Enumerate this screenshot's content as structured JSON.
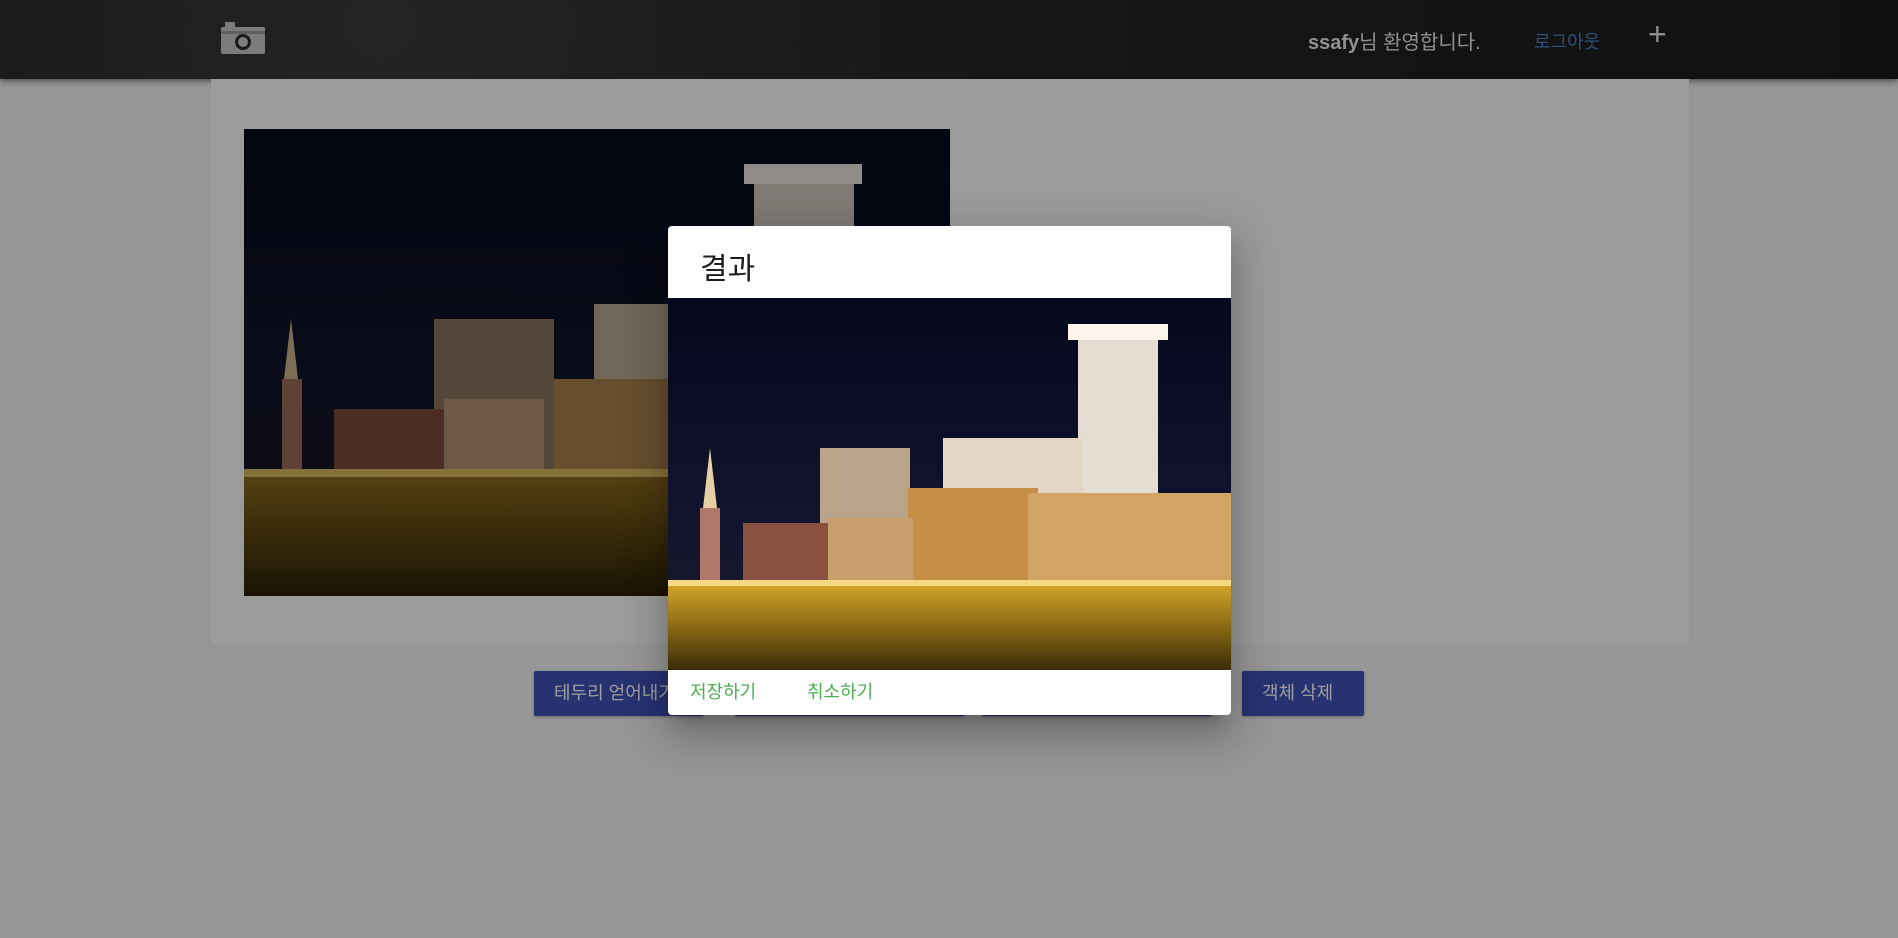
{
  "header": {
    "logo_icon": "camera-icon",
    "welcome_user": "ssafy",
    "welcome_suffix": "님 환영합니다.",
    "logout_label": "로그아웃",
    "add_icon": "plus-icon",
    "add_label": "+"
  },
  "toolbar": {
    "buttons": [
      {
        "label": "테두리 얻어내기"
      },
      {
        "label": ""
      },
      {
        "label": ""
      },
      {
        "label": "객체 삭제"
      }
    ]
  },
  "dialog": {
    "title": "결과",
    "save_label": "저장하기",
    "cancel_label": "취소하기"
  },
  "colors": {
    "header_bg": "#1f1f1f",
    "primary_button": "#3f51b5",
    "link_blue": "#4a86c8",
    "action_green": "#4caf50"
  }
}
